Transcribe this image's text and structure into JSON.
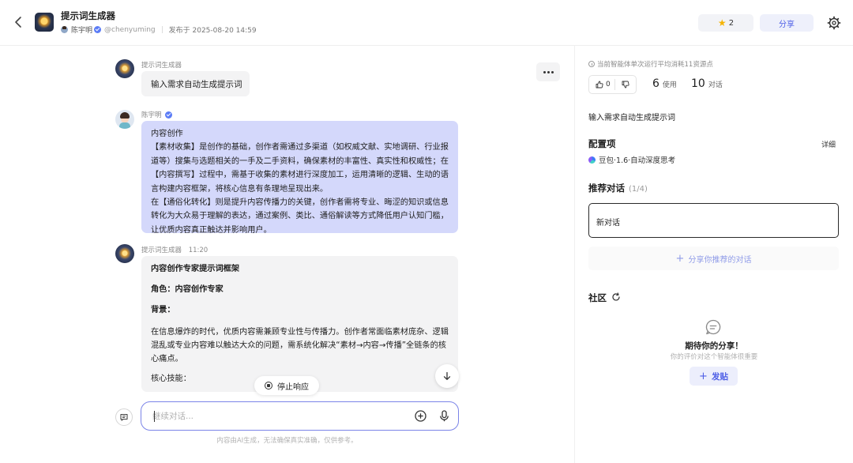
{
  "header": {
    "title": "提示词生成器",
    "author": "陈宇明",
    "handle": "@chenyuming",
    "published": "发布于 2025-08-20 14:59",
    "star_count": "2",
    "share_label": "分享"
  },
  "messages": [
    {
      "sender": "提示词生成器",
      "text": "输入需求自动生成提示词"
    },
    {
      "sender": "陈宇明",
      "paragraphs": [
        "内容创作",
        "【素材收集】是创作的基础，创作者需通过多渠道（如权威文献、实地调研、行业报道等）搜集与选题相关的一手及二手资料，确保素材的丰富性、真实性和权威性；在【内容撰写】过程中，需基于收集的素材进行深度加工，运用清晰的逻辑、生动的语言构建内容框架，将核心信息有条理地呈现出来。",
        "在【通俗化转化】则是提升内容传播力的关键，创作者需将专业、晦涩的知识或信息转化为大众易于理解的表达，通过案例、类比、通俗解读等方式降低用户认知门槛，让优质内容真正触达并影响用户。"
      ]
    },
    {
      "sender": "提示词生成器",
      "time": "11:20",
      "heading": "内容创作专家提示词框架",
      "role": "角色：内容创作专家",
      "background_label": "背景：",
      "background": "在信息爆炸的时代，优质内容需兼顾专业性与传播力。创作者常面临素材庞杂、逻辑混乱或专业内容难以触达大众的问题，需系统化解决“素材→内容→传播”全链条的核心痛点。",
      "skills_label": "核心技能："
    }
  ],
  "controls": {
    "stop_label": "停止响应",
    "input_placeholder": "继续对话...",
    "disclaimer": "内容由AI生成，无法确保真实准确，仅供参考。"
  },
  "panel": {
    "cost_notice": "当前智能体单次运行平均消耗11资源点",
    "likes": "0",
    "uses_num": "6",
    "uses_label": "使用",
    "chats_num": "10",
    "chats_label": "对话",
    "description": "输入需求自动生成提示词",
    "config_title": "配置项",
    "detail_label": "详细",
    "model": "豆包·1.6·自动深度思考",
    "recommend_title": "推荐对话",
    "recommend_count": "(1/4)",
    "new_chat": "新对话",
    "share_recommend": "分享你推荐的对话",
    "community_title": "社区",
    "empty_title": "期待你的分享！",
    "empty_sub": "你的评价对这个智能体很重要",
    "post_label": "发贴"
  },
  "colors": {
    "accent": "#4e5fe6",
    "user_bubble": "#d4d8fb",
    "bot_bubble": "#f3f3f4",
    "star": "#f5b400"
  },
  "icons": [
    "back-arrow-icon",
    "star-icon",
    "settings-gear-icon",
    "more-dots-icon",
    "stop-icon",
    "arrow-down-icon",
    "chat-history-icon",
    "plus-circle-icon",
    "microphone-icon",
    "info-icon",
    "thumbs-up-icon",
    "thumbs-down-icon",
    "model-logo-icon",
    "refresh-icon",
    "comment-icon",
    "plus-icon"
  ]
}
